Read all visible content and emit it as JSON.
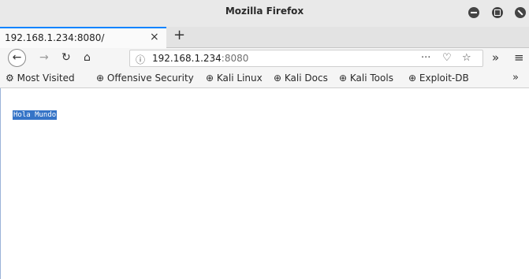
{
  "window": {
    "title": "Mozilla Firefox"
  },
  "tab": {
    "title": "192.168.1.234:8080/",
    "close": "×",
    "new_tab": "+"
  },
  "nav": {
    "back_glyph": "←",
    "forward_glyph": "→",
    "reload_glyph": "↻",
    "home_glyph": "⌂",
    "info_glyph": "ⓘ",
    "url_host": "192.168.1.234",
    "url_port": ":8080",
    "more_glyph": "···",
    "pocket_glyph": "♡",
    "star_glyph": "☆",
    "overflow_glyph": "»",
    "menu_glyph": "≡"
  },
  "bookmarks": {
    "items": [
      "Most Visited",
      "Offensive Security",
      "Kali Linux",
      "Kali Docs",
      "Kali Tools",
      "Exploit-DB"
    ],
    "most_visited_glyph": "⚙",
    "globe_glyph": "⊕",
    "chevron": "»"
  },
  "page": {
    "text": "Hola Mundo"
  },
  "colors": {
    "accent": "#0a84ff",
    "selection": "#3574c7"
  }
}
